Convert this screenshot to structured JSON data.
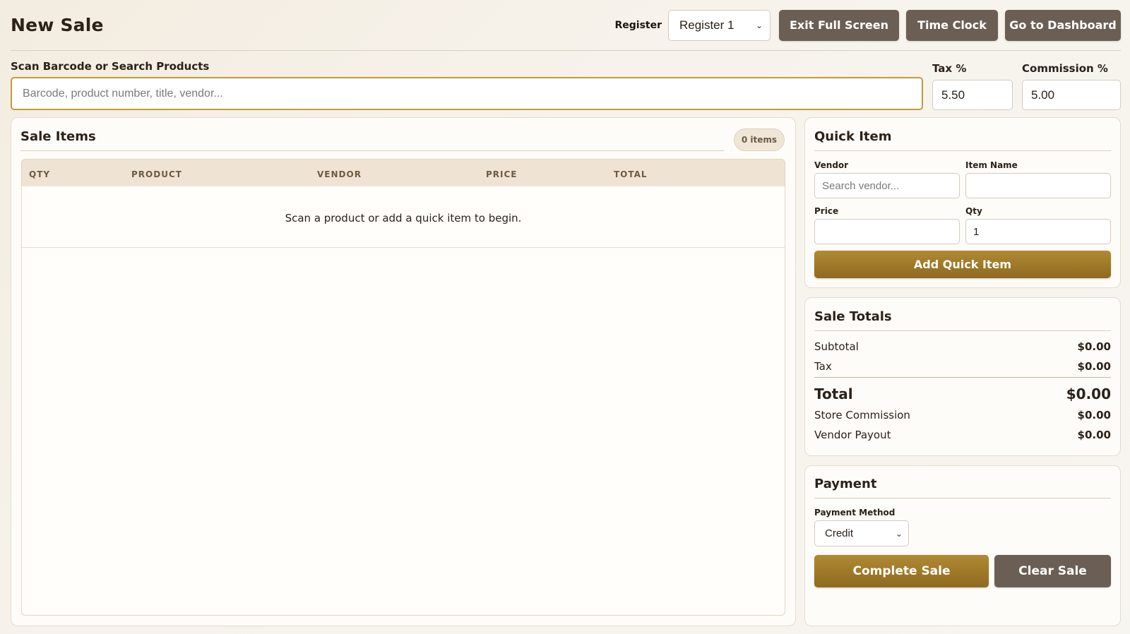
{
  "header": {
    "title": "New Sale",
    "register_label": "Register",
    "register_value": "Register 1",
    "buttons": {
      "exit_fullscreen": "Exit Full Screen",
      "time_clock": "Time Clock",
      "dashboard": "Go to Dashboard"
    }
  },
  "search": {
    "label": "Scan Barcode or Search Products",
    "placeholder": "Barcode, product number, title, vendor..."
  },
  "tax": {
    "label": "Tax %",
    "value": "5.50"
  },
  "commission": {
    "label": "Commission %",
    "value": "5.00"
  },
  "sale_items": {
    "title": "Sale Items",
    "count_badge": "0 items",
    "columns": [
      "QTY",
      "PRODUCT",
      "VENDOR",
      "PRICE",
      "TOTAL"
    ],
    "empty_message": "Scan a product or add a quick item to begin."
  },
  "quick_item": {
    "title": "Quick Item",
    "vendor_label": "Vendor",
    "vendor_placeholder": "Search vendor...",
    "item_name_label": "Item Name",
    "item_name_value": "",
    "price_label": "Price",
    "price_value": "",
    "qty_label": "Qty",
    "qty_value": "1",
    "add_button": "Add Quick Item"
  },
  "totals": {
    "title": "Sale Totals",
    "subtotal_label": "Subtotal",
    "subtotal": "$0.00",
    "tax_label": "Tax",
    "tax": "$0.00",
    "total_label": "Total",
    "total": "$0.00",
    "commission_label": "Store Commission",
    "commission": "$0.00",
    "payout_label": "Vendor Payout",
    "payout": "$0.00"
  },
  "payment": {
    "title": "Payment",
    "method_label": "Payment Method",
    "method_value": "Credit",
    "complete_button": "Complete Sale",
    "clear_button": "Clear Sale"
  },
  "colors": {
    "accent_gold": "#a07a2a",
    "dark_button": "#6b5f55",
    "background": "#f5efe5"
  }
}
